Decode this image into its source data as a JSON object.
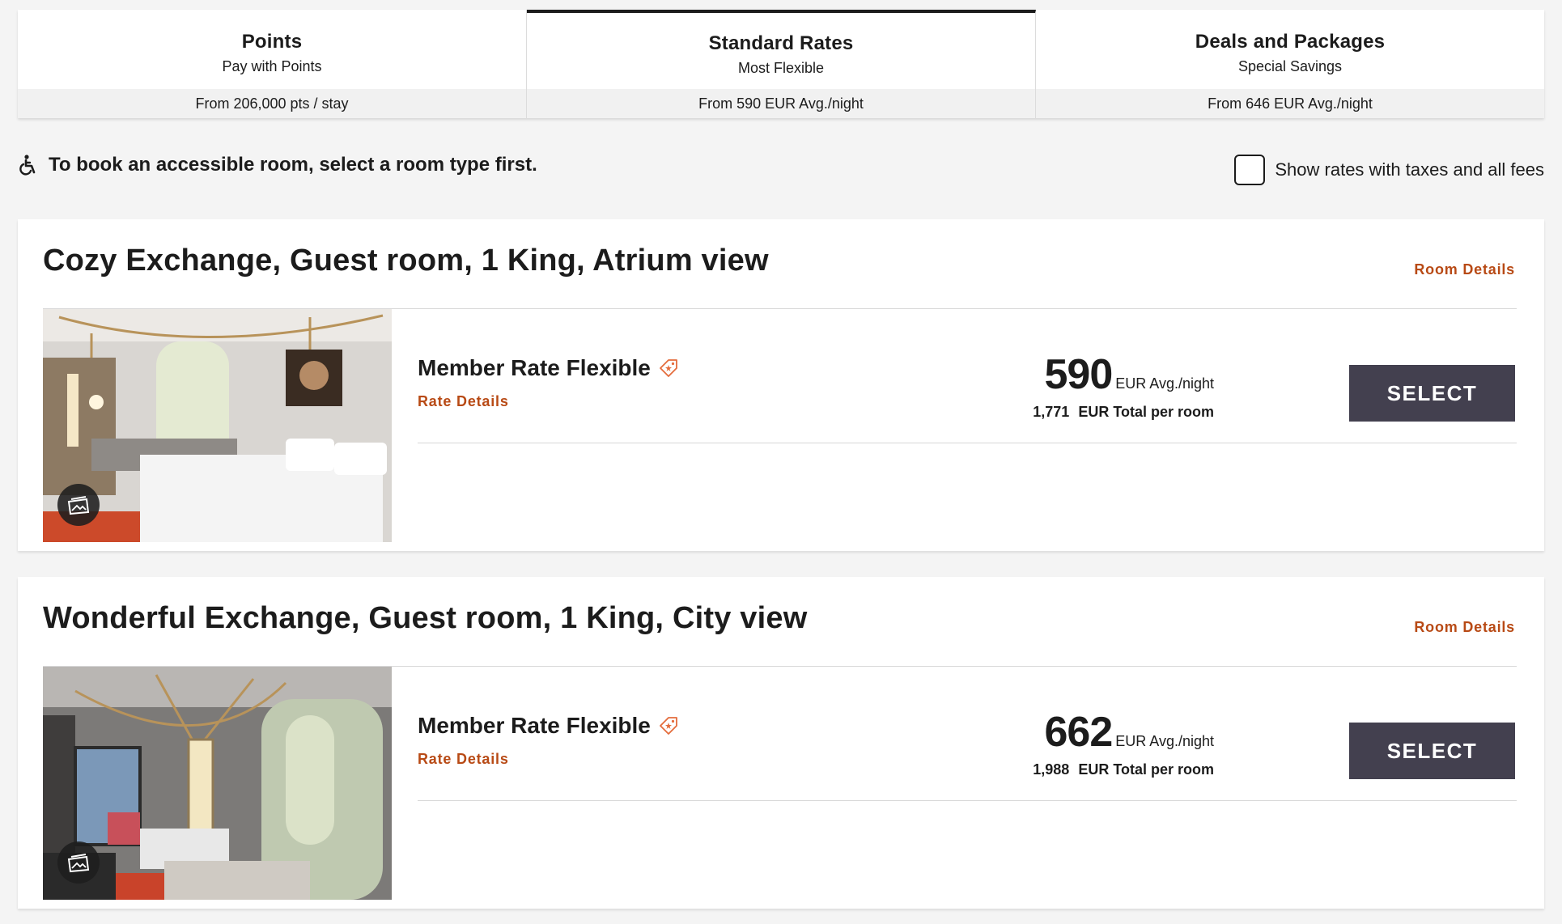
{
  "tabs": [
    {
      "title": "Points",
      "subtitle": "Pay with Points",
      "price": "From 206,000 pts / stay",
      "active": false
    },
    {
      "title": "Standard Rates",
      "subtitle": "Most Flexible",
      "price": "From 590 EUR Avg./night",
      "active": true
    },
    {
      "title": "Deals and Packages",
      "subtitle": "Special Savings",
      "price": "From 646 EUR Avg./night",
      "active": false
    }
  ],
  "accessibility_note": "To book an accessible room, select a room type first.",
  "tax_toggle_label": "Show rates with taxes and all fees",
  "room_details_label": "Room Details",
  "rooms": [
    {
      "title": "Cozy Exchange, Guest room, 1 King, Atrium view",
      "rate_name": "Member Rate Flexible",
      "rate_details_label": "Rate Details",
      "price": "590",
      "price_unit": "EUR Avg./night",
      "total_amount": "1,771",
      "total_label": "EUR Total per room",
      "select_label": "SELECT"
    },
    {
      "title": "Wonderful Exchange, Guest room, 1 King, City view",
      "rate_name": "Member Rate Flexible",
      "rate_details_label": "Rate Details",
      "price": "662",
      "price_unit": "EUR Avg./night",
      "total_amount": "1,988",
      "total_label": "EUR Total per room",
      "select_label": "SELECT"
    }
  ],
  "colors": {
    "link": "#b84a15",
    "select_button": "#43404f",
    "active_tab_border": "#1c1c1c"
  }
}
